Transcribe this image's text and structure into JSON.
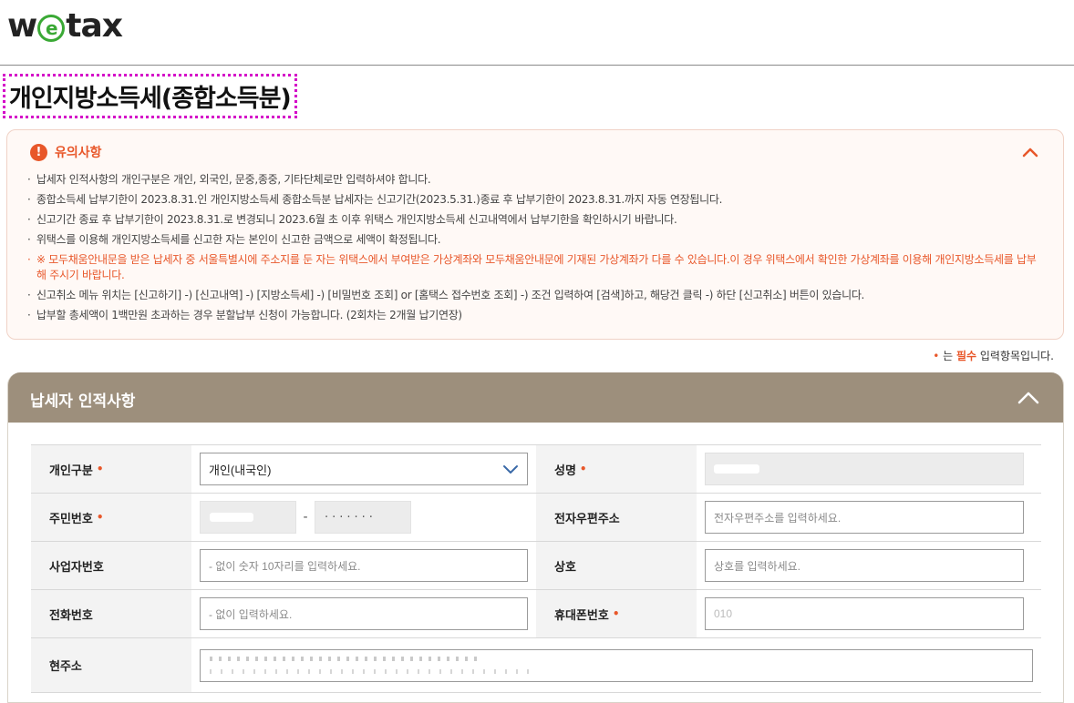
{
  "brand": {
    "logo_pre": "w",
    "logo_e": "e",
    "logo_post": "tax"
  },
  "page": {
    "title": "개인지방소득세(종합소득분)"
  },
  "notice": {
    "title": "유의사항",
    "items": [
      "납세자 인적사항의 개인구분은 개인, 외국인, 문중,종중, 기타단체로만 입력하셔야 합니다.",
      "종합소득세 납부기한이 2023.8.31.인 개인지방소득세 종합소득분 납세자는 신고기간(2023.5.31.)종료 후 납부기한이 2023.8.31.까지 자동 연장됩니다.",
      "신고기간 종료 후 납부기한이 2023.8.31.로 변경되니 2023.6월 초 이후 위택스 개인지방소득세 신고내역에서 납부기한을 확인하시기 바랍니다.",
      "위택스를 이용해 개인지방소득세를 신고한 자는 본인이 신고한 금액으로 세액이 확정됩니다.",
      "※ 모두채움안내문을 받은 납세자 중 서울특별시에 주소지를 둔 자는 위택스에서 부여받은 가상계좌와 모두채움안내문에 기재된 가상계좌가 다를 수 있습니다.이 경우 위택스에서 확인한 가상계좌를 이용해 개인지방소득세를 납부해 주시기 바랍니다.",
      "신고취소 메뉴 위치는 [신고하기] -) [신고내역] -) [지방소득세] -) [비밀번호 조회] or [홈택스 접수번호 조회] -) 조건 입력하여 [검색]하고, 해당건 클릭 -) 하단 [신고취소] 버튼이 있습니다.",
      "납부할 총세액이 1백만원 초과하는 경우 분할납부 신청이 가능합니다. (2회차는 2개월 납기연장)"
    ]
  },
  "required_note": {
    "dot": "•",
    "pre": " 는 ",
    "must": "필수",
    "post": " 입력항목입니다."
  },
  "panel": {
    "title": "납세자 인적사항",
    "fields": {
      "type_label": "개인구분",
      "type_value": "개인(내국인)",
      "name_label": "성명",
      "rrn_label": "주민번호",
      "rrn_back": "·······",
      "rrn_dash": "-",
      "email_label": "전자우편주소",
      "email_placeholder": "전자우편주소를 입력하세요.",
      "biz_label": "사업자번호",
      "biz_placeholder": "- 없이 숫자 10자리를 입력하세요.",
      "company_label": "상호",
      "company_placeholder": "상호를 입력하세요.",
      "phone_label": "전화번호",
      "phone_placeholder": "- 없이 입력하세요.",
      "mobile_label": "휴대폰번호",
      "mobile_value": "010",
      "address_label": "현주소"
    },
    "required_mark": "•"
  },
  "colors": {
    "accent": "#e8572a",
    "panel_header": "#9d8f7c",
    "highlight_border": "#d400c8",
    "logo_green": "#3aa935"
  }
}
